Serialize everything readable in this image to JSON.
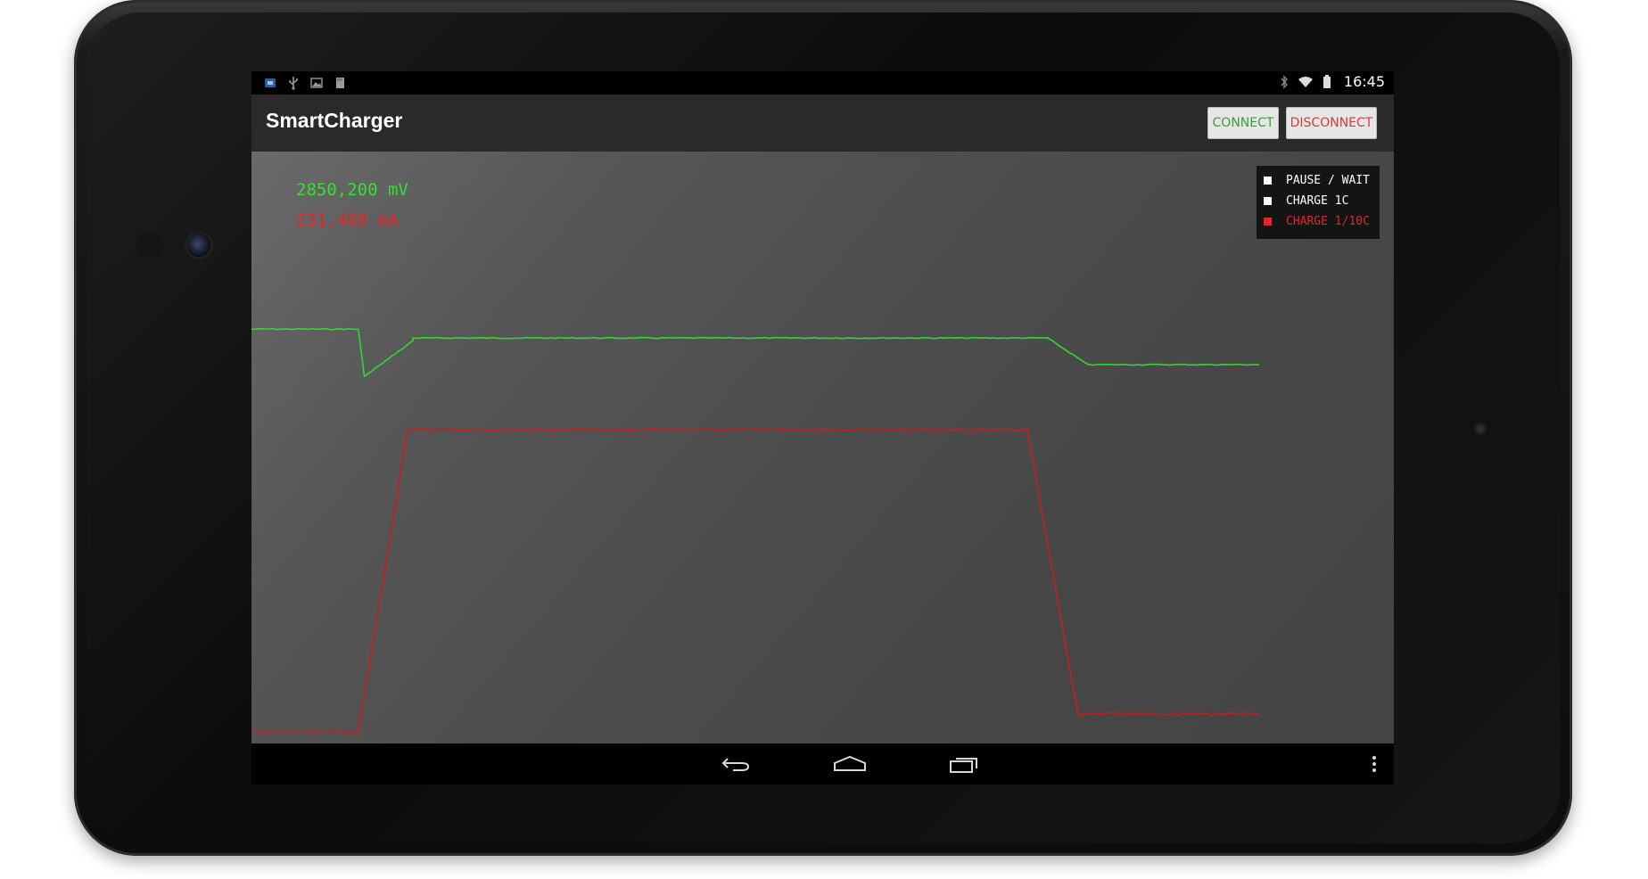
{
  "status_bar": {
    "left_icons": [
      "notification-app-icon",
      "usb-icon",
      "image-icon",
      "sd-card-icon"
    ],
    "right_icons": [
      "bluetooth-icon",
      "wifi-icon",
      "battery-icon"
    ],
    "time": "16:45"
  },
  "action_bar": {
    "title": "SmartCharger",
    "connect_label": "CONNECT",
    "disconnect_label": "DISCONNECT"
  },
  "readouts": {
    "voltage": "2850,200 mV",
    "current": "231,400 mA"
  },
  "legend": {
    "items": [
      {
        "label": "PAUSE / WAIT",
        "color": "#ffffff"
      },
      {
        "label": "CHARGE 1C",
        "color": "#ffffff"
      },
      {
        "label": "CHARGE 1/10C",
        "color": "#e02828"
      }
    ]
  },
  "colors": {
    "voltage_line": "#33d633",
    "current_line": "#c81e1e",
    "connect_text": "#3b9c3b",
    "disconnect_text": "#d43b3b"
  },
  "chart_data": {
    "type": "line",
    "series": [
      {
        "values_kind": "voltage",
        "segments": [
          {
            "from": 0,
            "to": 0.106,
            "level": 0.7
          },
          {
            "from": 0.106,
            "to": 0.112,
            "level": 0.62
          },
          {
            "from": 0.112,
            "to": 0.16,
            "level": 0.68
          },
          {
            "from": 0.16,
            "to": 0.79,
            "level": 0.685
          },
          {
            "from": 0.79,
            "to": 0.83,
            "level": 0.64
          },
          {
            "from": 0.83,
            "to": 1.0,
            "level": 0.64
          }
        ]
      },
      {
        "values_kind": "current",
        "segments": [
          {
            "from": 0,
            "to": 0.106,
            "level": 0.02
          },
          {
            "from": 0.106,
            "to": 0.155,
            "level": 0.53
          },
          {
            "from": 0.155,
            "to": 0.77,
            "level": 0.53
          },
          {
            "from": 0.77,
            "to": 0.82,
            "level": 0.05
          },
          {
            "from": 0.82,
            "to": 1.0,
            "level": 0.05
          }
        ]
      }
    ]
  }
}
